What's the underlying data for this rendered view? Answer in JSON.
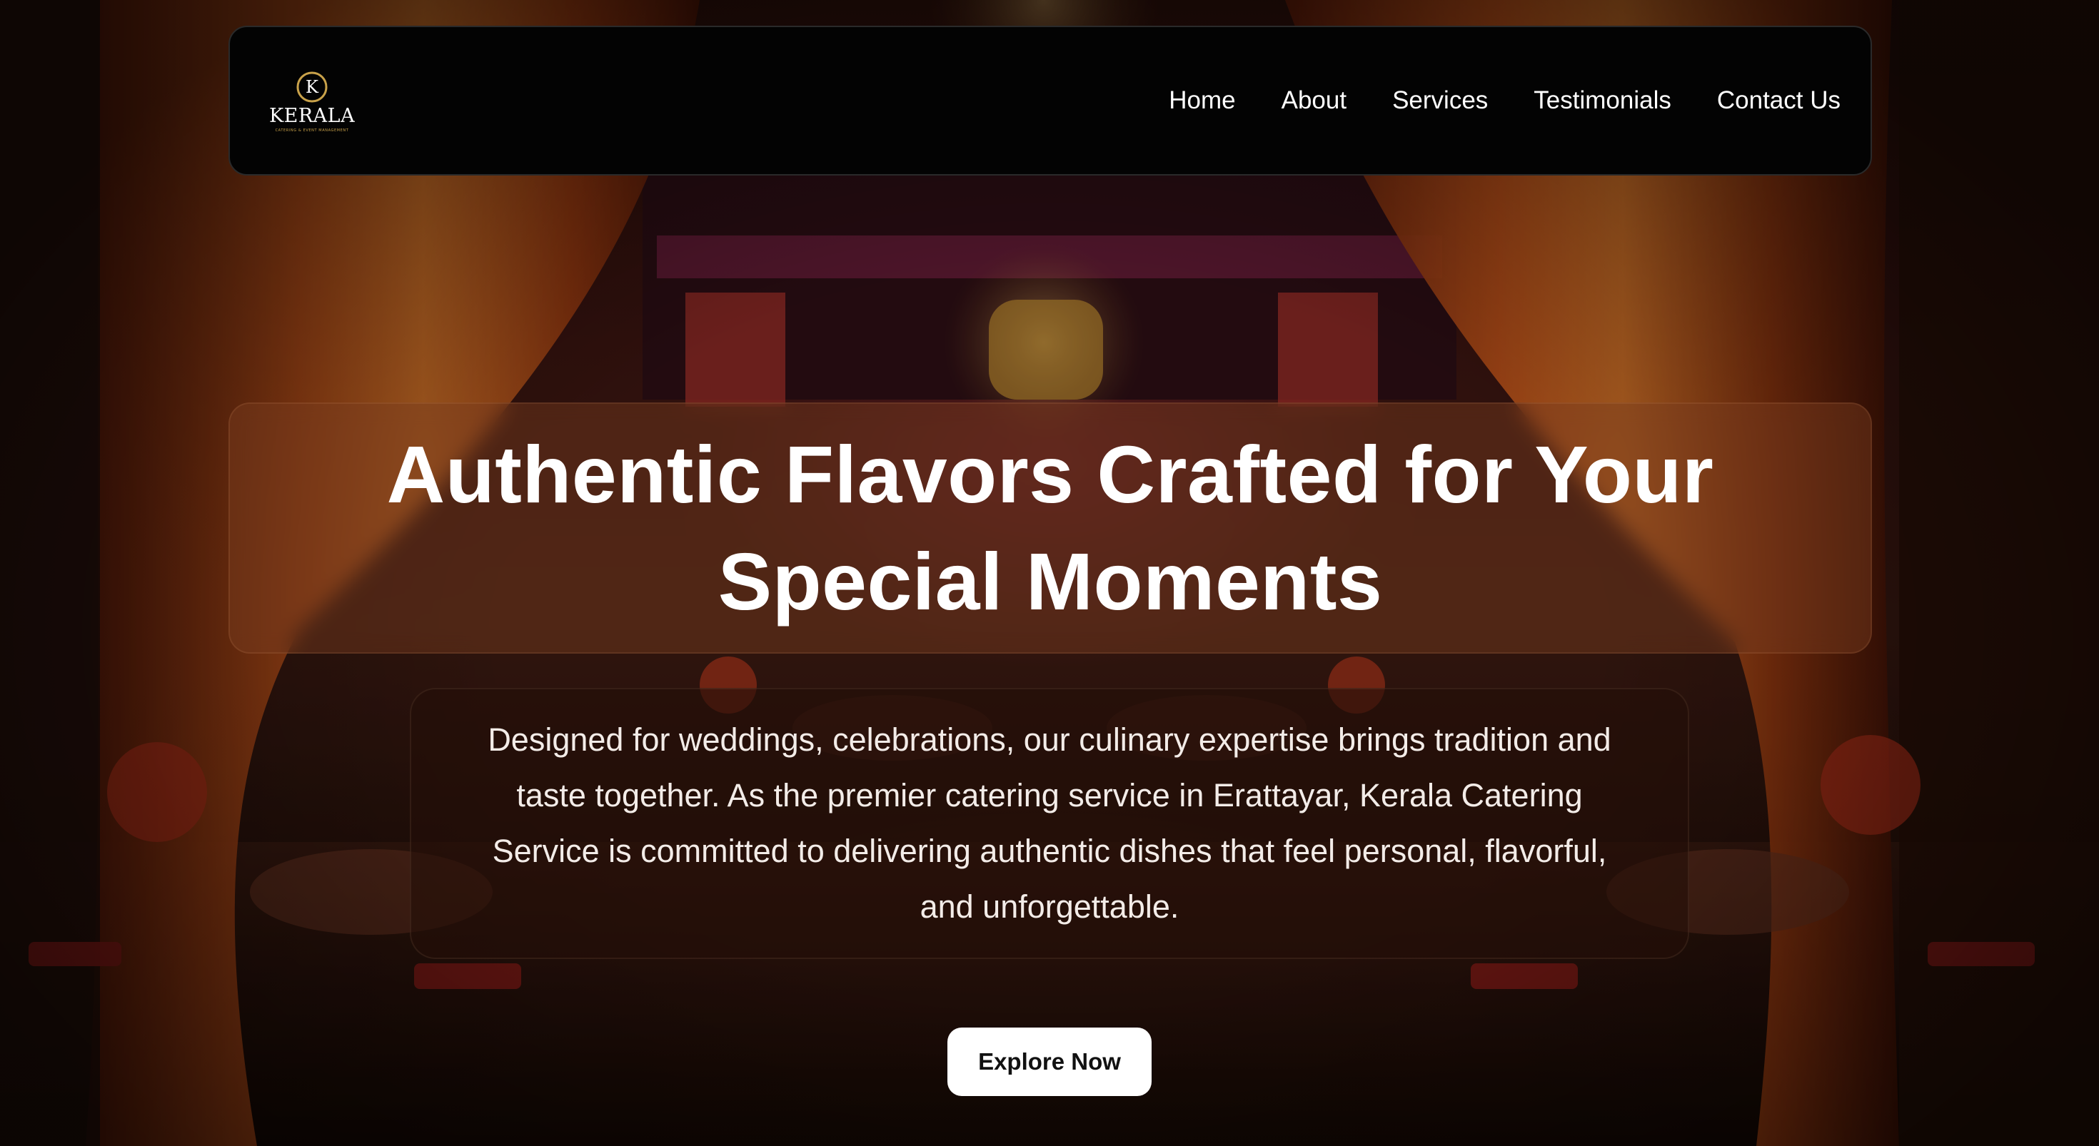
{
  "brand": {
    "logo_text": "KERALA",
    "logo_subtitle": "CATERING & EVENT MANAGEMENT",
    "logo_initial": "K",
    "accent_color": "#c9a24a"
  },
  "nav": {
    "items": [
      {
        "label": "Home"
      },
      {
        "label": "About"
      },
      {
        "label": "Services"
      },
      {
        "label": "Testimonials"
      },
      {
        "label": "Contact Us"
      }
    ]
  },
  "hero": {
    "title": "Authentic Flavors Crafted for Your Special Moments",
    "description": "Designed for weddings, celebrations, our culinary expertise brings tradition and taste together. As the premier catering service in Erattayar, Kerala Catering Service is committed to delivering authentic dishes that feel personal, flavorful, and unforgettable.",
    "cta_label": "Explore Now"
  },
  "colors": {
    "navbar_bg": "#030303",
    "cta_bg": "#ffffff",
    "text": "#ffffff"
  }
}
